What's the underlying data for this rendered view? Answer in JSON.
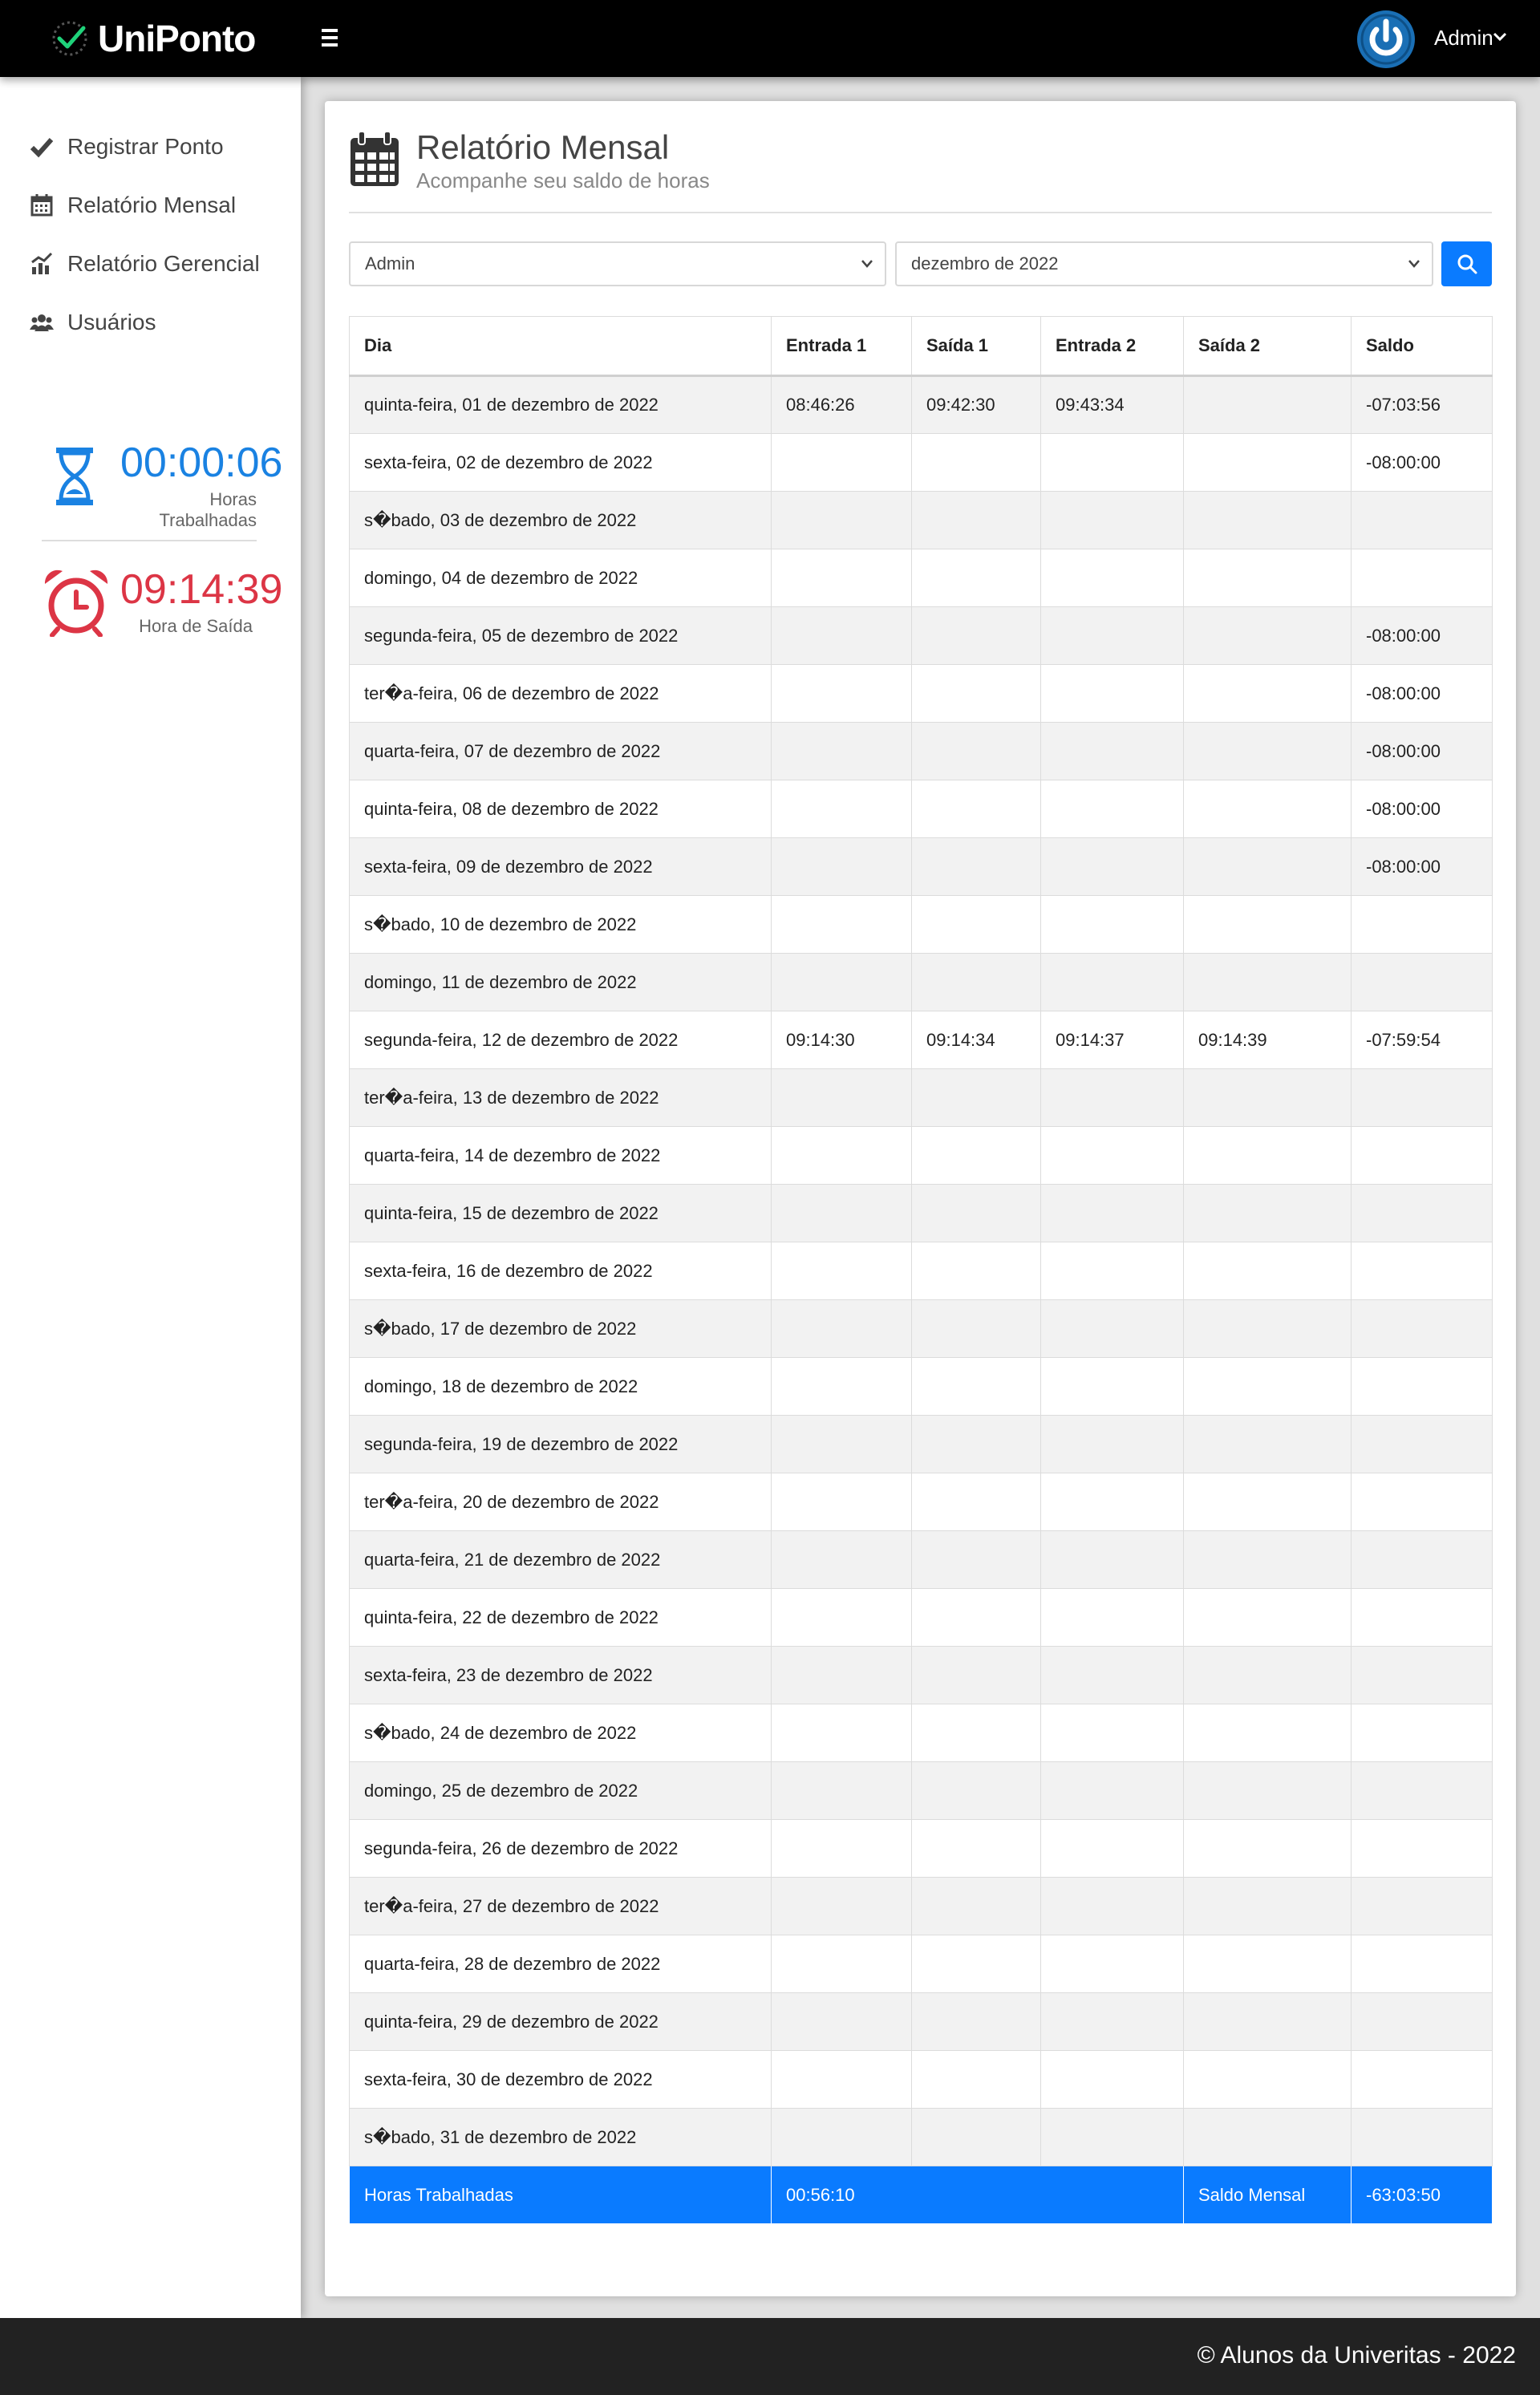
{
  "app": {
    "name": "UniPonto",
    "user_name": "Admin"
  },
  "sidebar": {
    "items": [
      {
        "label": "Registrar Ponto",
        "icon": "check-icon"
      },
      {
        "label": "Relatório Mensal",
        "icon": "calendar-icon"
      },
      {
        "label": "Relatório Gerencial",
        "icon": "chart-icon"
      },
      {
        "label": "Usuários",
        "icon": "users-icon"
      }
    ],
    "worked": {
      "value": "00:00:06",
      "label": "Horas Trabalhadas",
      "color": "#1a82e2",
      "icon": "hourglass-icon"
    },
    "exit": {
      "value": "09:14:39",
      "label": "Hora de Saída",
      "color": "#dc3545",
      "icon": "alarm-clock-icon"
    }
  },
  "page": {
    "title": "Relatório Mensal",
    "subtitle": "Acompanhe seu saldo de horas",
    "icon": "calendar-icon"
  },
  "filters": {
    "user_select": "Admin",
    "month_select": "dezembro de 2022",
    "search_icon": "search-icon"
  },
  "table": {
    "headers": [
      "Dia",
      "Entrada 1",
      "Saída 1",
      "Entrada 2",
      "Saída 2",
      "Saldo"
    ],
    "rows": [
      [
        "quinta-feira, 01 de dezembro de 2022",
        "08:46:26",
        "09:42:30",
        "09:43:34",
        "",
        "-07:03:56"
      ],
      [
        "sexta-feira, 02 de dezembro de 2022",
        "",
        "",
        "",
        "",
        "-08:00:00"
      ],
      [
        "s�bado, 03 de dezembro de 2022",
        "",
        "",
        "",
        "",
        ""
      ],
      [
        "domingo, 04 de dezembro de 2022",
        "",
        "",
        "",
        "",
        ""
      ],
      [
        "segunda-feira, 05 de dezembro de 2022",
        "",
        "",
        "",
        "",
        "-08:00:00"
      ],
      [
        "ter�a-feira, 06 de dezembro de 2022",
        "",
        "",
        "",
        "",
        "-08:00:00"
      ],
      [
        "quarta-feira, 07 de dezembro de 2022",
        "",
        "",
        "",
        "",
        "-08:00:00"
      ],
      [
        "quinta-feira, 08 de dezembro de 2022",
        "",
        "",
        "",
        "",
        "-08:00:00"
      ],
      [
        "sexta-feira, 09 de dezembro de 2022",
        "",
        "",
        "",
        "",
        "-08:00:00"
      ],
      [
        "s�bado, 10 de dezembro de 2022",
        "",
        "",
        "",
        "",
        ""
      ],
      [
        "domingo, 11 de dezembro de 2022",
        "",
        "",
        "",
        "",
        ""
      ],
      [
        "segunda-feira, 12 de dezembro de 2022",
        "09:14:30",
        "09:14:34",
        "09:14:37",
        "09:14:39",
        "-07:59:54"
      ],
      [
        "ter�a-feira, 13 de dezembro de 2022",
        "",
        "",
        "",
        "",
        ""
      ],
      [
        "quarta-feira, 14 de dezembro de 2022",
        "",
        "",
        "",
        "",
        ""
      ],
      [
        "quinta-feira, 15 de dezembro de 2022",
        "",
        "",
        "",
        "",
        ""
      ],
      [
        "sexta-feira, 16 de dezembro de 2022",
        "",
        "",
        "",
        "",
        ""
      ],
      [
        "s�bado, 17 de dezembro de 2022",
        "",
        "",
        "",
        "",
        ""
      ],
      [
        "domingo, 18 de dezembro de 2022",
        "",
        "",
        "",
        "",
        ""
      ],
      [
        "segunda-feira, 19 de dezembro de 2022",
        "",
        "",
        "",
        "",
        ""
      ],
      [
        "ter�a-feira, 20 de dezembro de 2022",
        "",
        "",
        "",
        "",
        ""
      ],
      [
        "quarta-feira, 21 de dezembro de 2022",
        "",
        "",
        "",
        "",
        ""
      ],
      [
        "quinta-feira, 22 de dezembro de 2022",
        "",
        "",
        "",
        "",
        ""
      ],
      [
        "sexta-feira, 23 de dezembro de 2022",
        "",
        "",
        "",
        "",
        ""
      ],
      [
        "s�bado, 24 de dezembro de 2022",
        "",
        "",
        "",
        "",
        ""
      ],
      [
        "domingo, 25 de dezembro de 2022",
        "",
        "",
        "",
        "",
        ""
      ],
      [
        "segunda-feira, 26 de dezembro de 2022",
        "",
        "",
        "",
        "",
        ""
      ],
      [
        "ter�a-feira, 27 de dezembro de 2022",
        "",
        "",
        "",
        "",
        ""
      ],
      [
        "quarta-feira, 28 de dezembro de 2022",
        "",
        "",
        "",
        "",
        ""
      ],
      [
        "quinta-feira, 29 de dezembro de 2022",
        "",
        "",
        "",
        "",
        ""
      ],
      [
        "sexta-feira, 30 de dezembro de 2022",
        "",
        "",
        "",
        "",
        ""
      ],
      [
        "s�bado, 31 de dezembro de 2022",
        "",
        "",
        "",
        "",
        ""
      ]
    ],
    "footer": {
      "worked_label": "Horas Trabalhadas",
      "worked_value": "00:56:10",
      "balance_label": "Saldo Mensal",
      "balance_value": "-63:03:50"
    }
  },
  "footer": {
    "text": "© Alunos da Univeritas - 2022"
  },
  "colors": {
    "accent": "#0a7bff",
    "header_bg": "#000000",
    "footer_bg": "#222222"
  }
}
